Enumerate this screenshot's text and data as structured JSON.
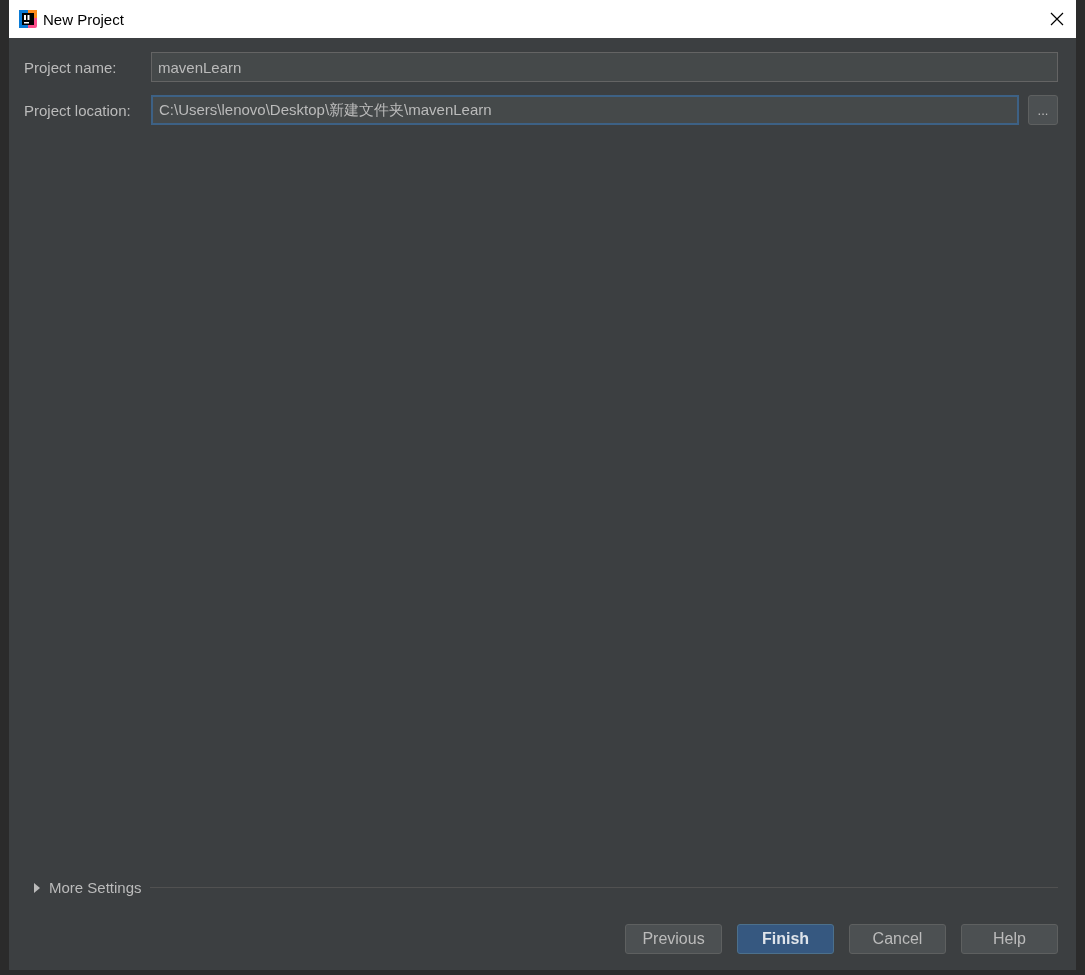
{
  "window": {
    "title": "New Project"
  },
  "fields": [
    {
      "label": "Project name:",
      "value": "mavenLearn",
      "focused": false,
      "browse": false
    },
    {
      "label": "Project location:",
      "value": "C:\\Users\\lenovo\\Desktop\\新建文件夹\\mavenLearn",
      "focused": true,
      "browse": true,
      "browse_label": "..."
    }
  ],
  "more_settings": {
    "label": "More Settings",
    "expanded": false
  },
  "buttons": [
    {
      "label": "Previous",
      "default": false
    },
    {
      "label": "Finish",
      "default": true
    },
    {
      "label": "Cancel",
      "default": false
    },
    {
      "label": "Help",
      "default": false
    }
  ]
}
